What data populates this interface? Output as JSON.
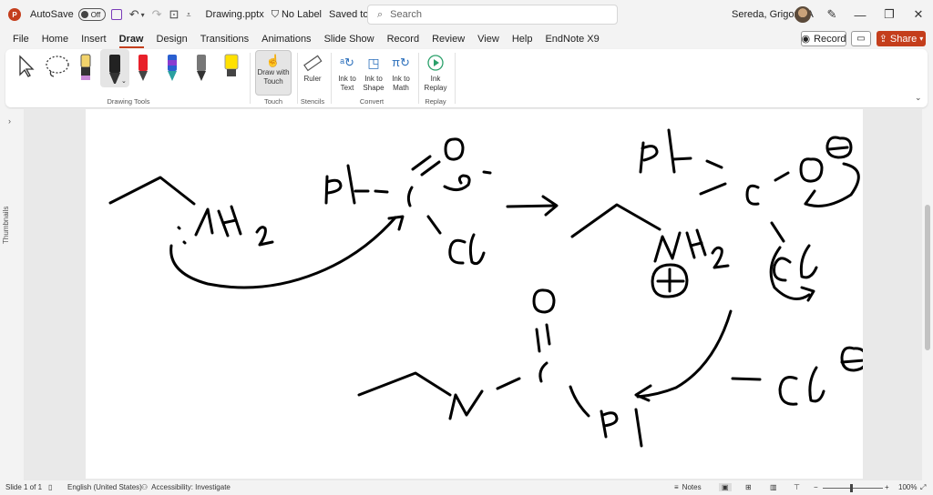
{
  "titlebar": {
    "autosave_label": "AutoSave",
    "autosave_state": "Off",
    "filename": "Drawing.pptx",
    "sensitivity": "No Label",
    "save_status": "Saved to this PC",
    "search_placeholder": "Search",
    "user_name": "Sereda, Grigoriy A"
  },
  "menu": {
    "items": [
      "File",
      "Home",
      "Insert",
      "Draw",
      "Design",
      "Transitions",
      "Animations",
      "Slide Show",
      "Record",
      "Review",
      "View",
      "Help",
      "EndNote X9"
    ],
    "active": "Draw",
    "record_label": "Record",
    "share_label": "Share"
  },
  "ribbon": {
    "groups": {
      "drawing_tools": "Drawing Tools",
      "touch": "Touch",
      "stencils": "Stencils",
      "convert": "Convert",
      "replay": "Replay"
    },
    "draw_with_touch_line1": "Draw with",
    "draw_with_touch_line2": "Touch",
    "ruler": "Ruler",
    "ink_to_text_l1": "Ink to",
    "ink_to_text_l2": "Text",
    "ink_to_shape_l1": "Ink to",
    "ink_to_shape_l2": "Shape",
    "ink_to_math_l1": "Ink to",
    "ink_to_math_l2": "Math",
    "ink_replay_l1": "Ink",
    "ink_replay_l2": "Replay",
    "pen_colors": [
      "#000000",
      "#e8202a",
      "#2a5fd0",
      "#555555",
      "#ffe100"
    ]
  },
  "sidebar": {
    "thumbnails_label": "Thumbnails"
  },
  "status": {
    "slide": "Slide 1 of 1",
    "language": "English (United States)",
    "accessibility": "Accessibility: Investigate",
    "notes": "Notes",
    "zoom": "100%"
  }
}
